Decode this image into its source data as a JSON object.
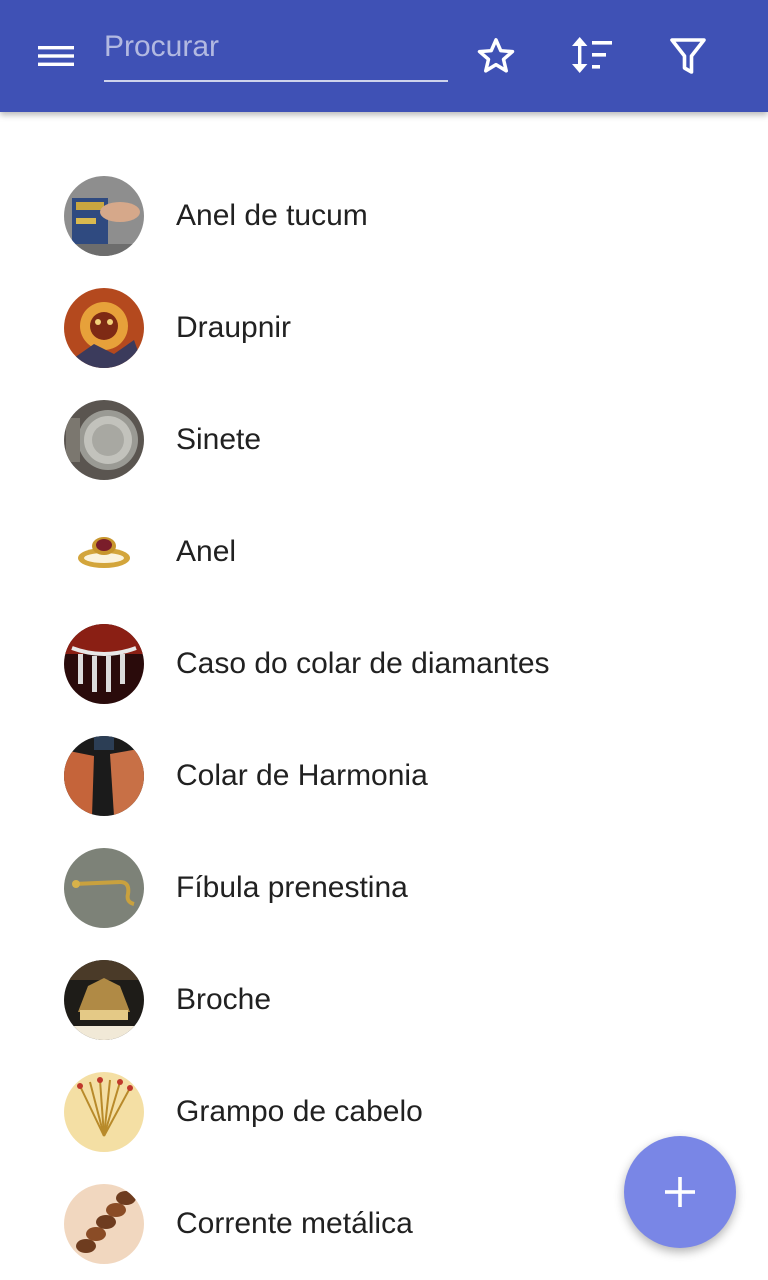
{
  "toolbar": {
    "search_placeholder": "Procurar",
    "search_value": "",
    "background_color": "#3f51b5",
    "icons": [
      "menu-icon",
      "star-outline-icon",
      "sort-icon",
      "filter-icon"
    ]
  },
  "items": [
    {
      "label": "Anel de tucum"
    },
    {
      "label": "Draupnir"
    },
    {
      "label": "Sinete"
    },
    {
      "label": "Anel"
    },
    {
      "label": "Caso do colar de diamantes"
    },
    {
      "label": "Colar de Harmonia"
    },
    {
      "label": "Fíbula prenestina"
    },
    {
      "label": "Broche"
    },
    {
      "label": "Grampo de cabelo"
    },
    {
      "label": "Corrente metálica"
    }
  ],
  "fab": {
    "icon": "plus-icon",
    "color": "#7986e6"
  }
}
